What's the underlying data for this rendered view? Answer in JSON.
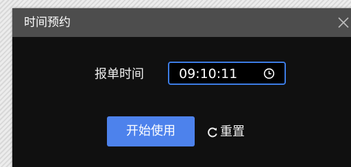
{
  "dialog": {
    "title": "时间预约",
    "close_icon": "close-icon"
  },
  "form": {
    "time_label": "报单时间",
    "time_value": "09:10:11",
    "time_icon": "clock-icon"
  },
  "actions": {
    "start_label": "开始使用",
    "reset_label": "重置",
    "reset_icon": "refresh-icon"
  },
  "colors": {
    "accent": "#4d82ec",
    "input_border": "#3d7de6",
    "dialog_bg": "#101010",
    "titlebar_bg": "#4d4d4d"
  }
}
